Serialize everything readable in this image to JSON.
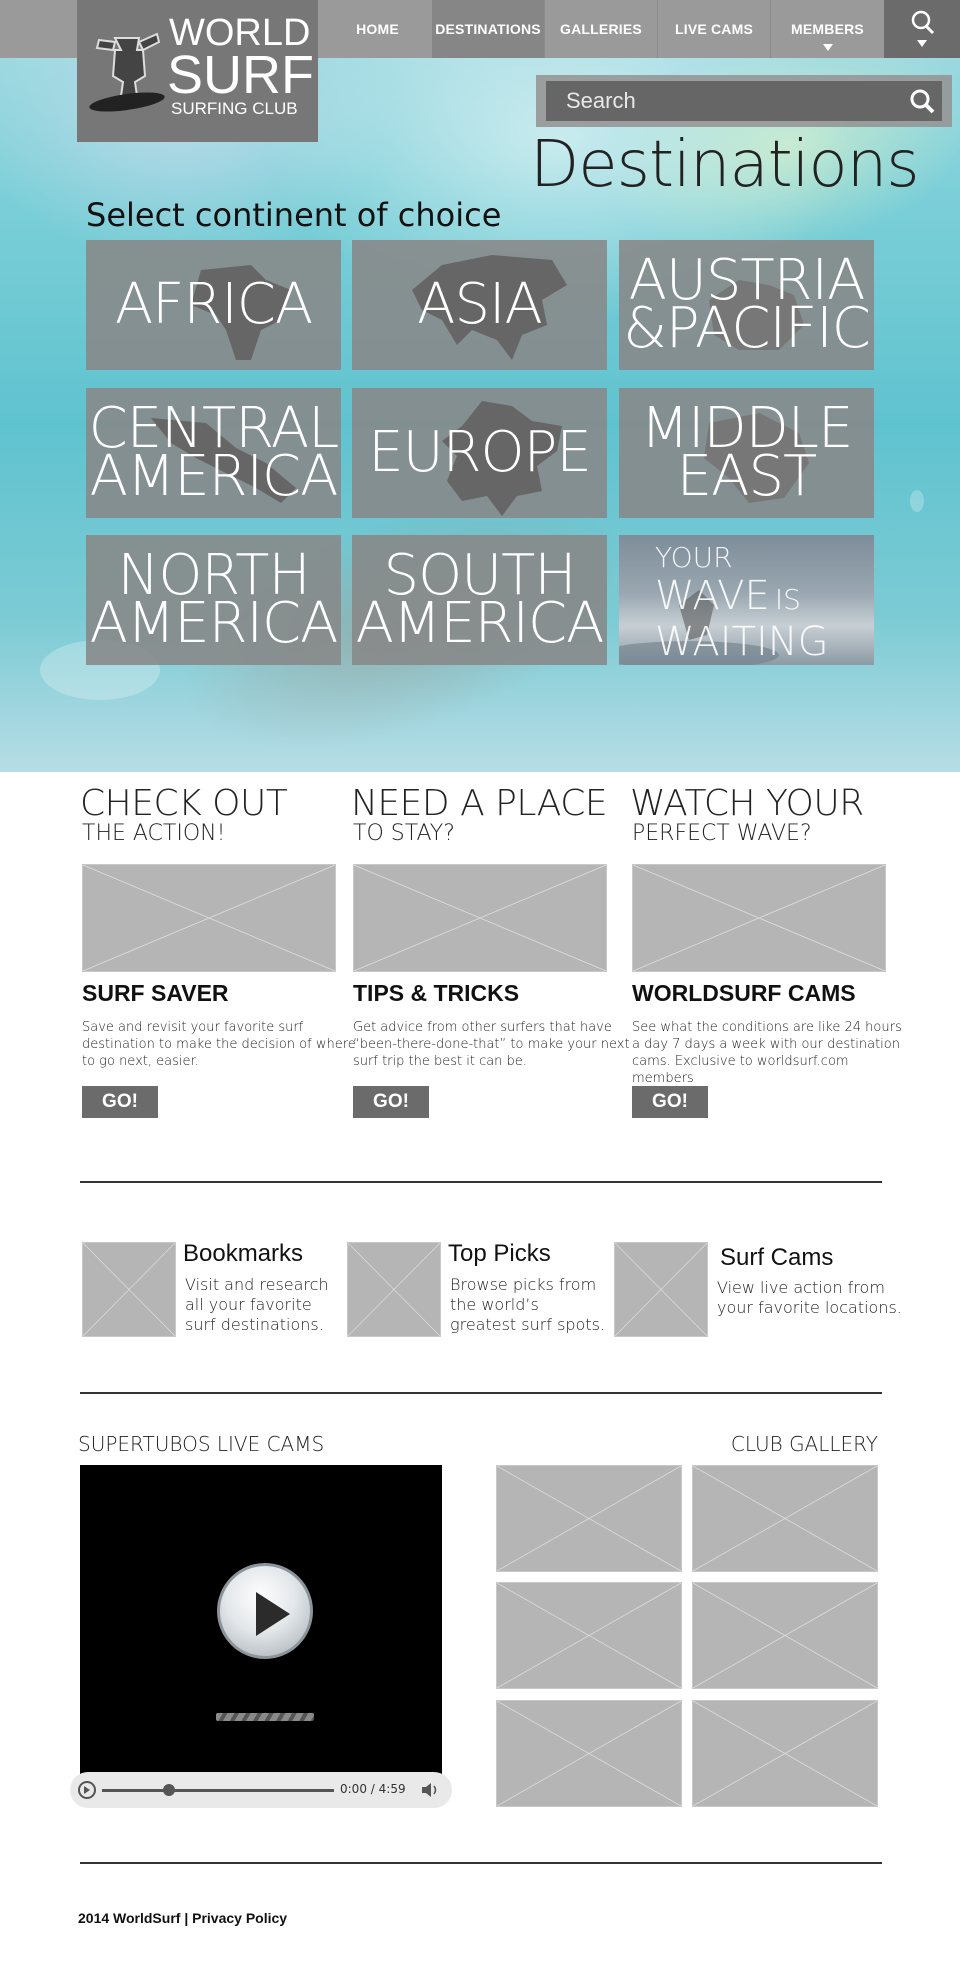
{
  "site": {
    "logo": {
      "line1": "WORLD",
      "line2": "SURF",
      "line3": "SURFING CLUB"
    }
  },
  "nav": {
    "items": [
      {
        "label": "HOME",
        "active": false
      },
      {
        "label": "DESTINATIONS",
        "active": true
      },
      {
        "label": "GALLERIES",
        "active": false
      },
      {
        "label": "LIVE CAMS",
        "active": false
      },
      {
        "label": "MEMBERS",
        "active": false
      }
    ]
  },
  "search": {
    "placeholder": "Search"
  },
  "destinations": {
    "title": "Destinations",
    "subtitle": "Select continent of choice",
    "tiles": [
      {
        "label": "AFRICA"
      },
      {
        "label": "ASIA"
      },
      {
        "label": "AUSTRIA\n&PACIFIC"
      },
      {
        "label": "CENTRAL\nAMERICA"
      },
      {
        "label": "EUROPE"
      },
      {
        "label": "MIDDLE\nEAST"
      },
      {
        "label": "NORTH\nAMERICA"
      },
      {
        "label": "SOUTH\nAMERICA"
      }
    ],
    "promo": {
      "line1": "YOUR",
      "line2a": "WAVE",
      "line2b": "IS",
      "line3": "WAITING"
    }
  },
  "features": [
    {
      "heading": "CHECK OUT",
      "subheading": "THE ACTION!",
      "title": "SURF SAVER",
      "text": "Save and revisit your favorite surf destination to make the decision of where to go next, easier.",
      "button": "GO!"
    },
    {
      "heading": "NEED A PLACE",
      "subheading": "TO STAY?",
      "title": "TIPS & TRICKS",
      "text": "Get advice from other surfers that have “been-there-done-that” to make your next surf trip the best it can be.",
      "button": "GO!"
    },
    {
      "heading": "WATCH YOUR",
      "subheading": "PERFECT WAVE?",
      "title": "WORLDSURF CAMS",
      "text": "See what the conditions are like 24 hours a day 7 days a week with our destination cams. Exclusive to worldsurf.com members",
      "button": "GO!"
    }
  ],
  "quicklinks": [
    {
      "title": "Bookmarks",
      "text": "Visit and research all your favorite surf destinations."
    },
    {
      "title": "Top Picks",
      "text": "Browse picks from the world’s greatest surf spots."
    },
    {
      "title": "Surf Cams",
      "text": "View live action from your favorite locations."
    }
  ],
  "livecams": {
    "title": "SUPERTUBOS LIVE CAMS",
    "player": {
      "current": "0:00",
      "separator": "/",
      "duration": "4:59",
      "progress": 0.25
    }
  },
  "gallery": {
    "title": "CLUB GALLERY",
    "count": 6
  },
  "footer": {
    "text": "2014 WorldSurf | Privacy Policy"
  },
  "colors": {
    "nav": "#9a9a9a",
    "navActive": "#868686",
    "tile": "#878787",
    "button": "#6b6b6b",
    "placeholder": "#b5b5b5"
  }
}
